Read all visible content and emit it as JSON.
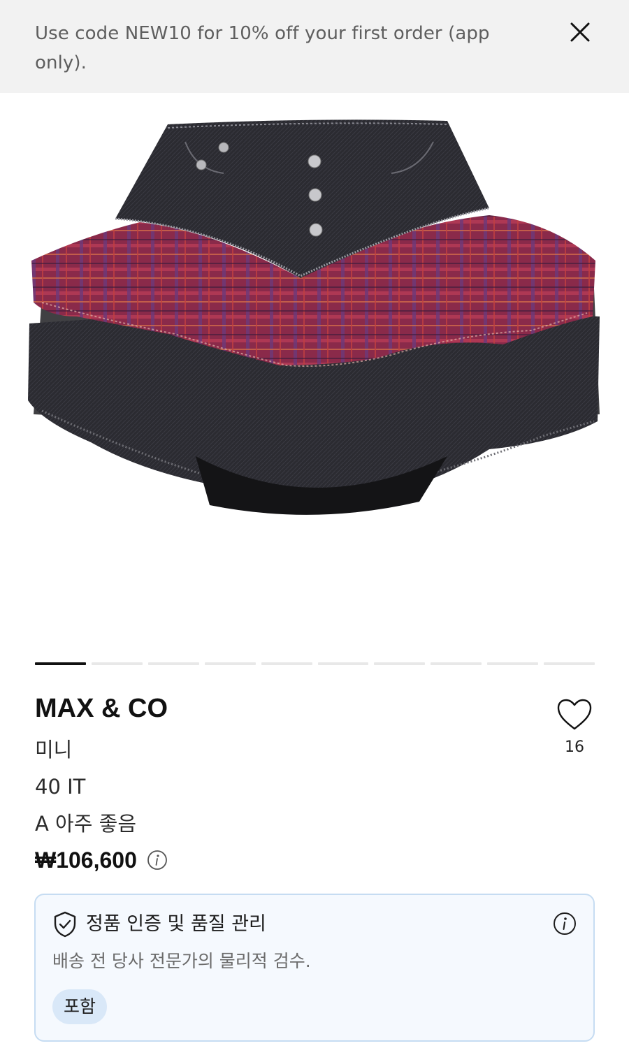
{
  "promo": {
    "text": "Use code NEW10 for 10% off your first order (app only).",
    "close_icon": "close-icon"
  },
  "gallery": {
    "total_images": 10,
    "current_index": 1
  },
  "product": {
    "brand": "MAX & CO",
    "category": "미니",
    "size": "40 IT",
    "condition": "A 아주 좋음",
    "price": "₩106,600",
    "favorites_count": "16"
  },
  "authentication": {
    "title": "정품 인증 및 품질 관리",
    "description": "배송 전 당사 전문가의 물리적 검수.",
    "badge": "포함"
  },
  "colors": {
    "banner_bg": "#f2f2f2",
    "card_bg": "#f5f9fe",
    "card_border": "#c6dcf2",
    "badge_bg": "#d9e8f8"
  }
}
